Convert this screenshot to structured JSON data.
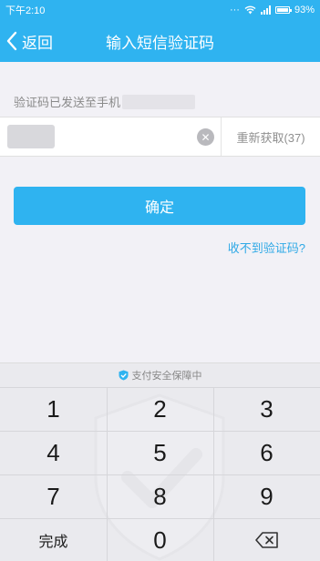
{
  "status_bar": {
    "time": "下午2:10",
    "battery": "93%",
    "battery_level": 0.93
  },
  "header": {
    "back_label": "返回",
    "title": "输入短信验证码"
  },
  "form": {
    "hint": "验证码已发送至手机",
    "code_value": "",
    "resend_label": "重新获取(37)",
    "confirm_label": "确定",
    "no_code_link": "收不到验证码?"
  },
  "keyboard": {
    "security_label": "支付安全保障中",
    "keys": [
      "1",
      "2",
      "3",
      "4",
      "5",
      "6",
      "7",
      "8",
      "9",
      "完成",
      "0",
      "backspace"
    ],
    "done_label": "完成",
    "zero_label": "0"
  },
  "colors": {
    "accent": "#2fb3f0",
    "background": "#f2f1f6",
    "link": "#2fa9e6"
  },
  "icons": {
    "back": "chevron-left-icon",
    "clear": "clear-icon",
    "shield": "shield-check-icon",
    "backspace": "backspace-icon",
    "wifi": "wifi-icon",
    "signal": "signal-icon",
    "battery": "battery-icon"
  }
}
